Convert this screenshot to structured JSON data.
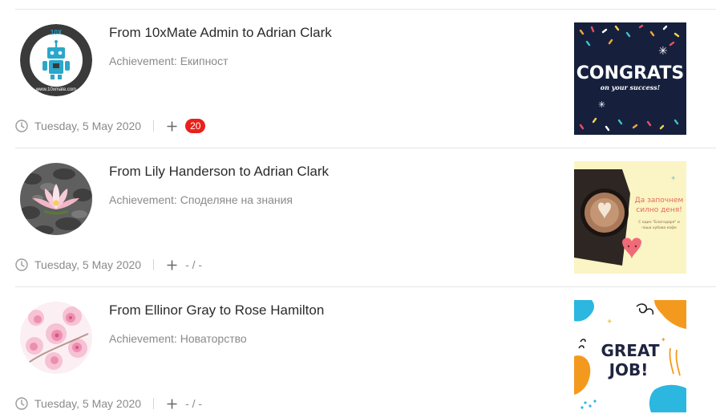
{
  "feed": {
    "items": [
      {
        "title": "From 10xMate Admin to Adrian Clark",
        "achievement": "Achievement: Екипност",
        "date": "Tuesday, 5 May 2020",
        "likes": "20",
        "avatar_icon": "robot-logo-icon",
        "avatar_logo_text": "10X",
        "avatar_url_text": "www.10xmate.com",
        "image_icon": "congrats-card-image",
        "image_text": {
          "main": "CONGRATS",
          "sub": "on your success!"
        }
      },
      {
        "title": "From Lily Handerson to Adrian Clark",
        "achievement": "Achievement: Споделяне на знания",
        "date": "Tuesday, 5 May 2020",
        "likes": "- / -",
        "avatar_icon": "lotus-flower-icon",
        "image_icon": "coffee-card-image",
        "image_text": {
          "main_line1": "Да започнем",
          "main_line2": "силно деня!",
          "sub_line1": "С един \"Благодаря\" и",
          "sub_line2": "чаша хубаво кафе"
        }
      },
      {
        "title": "From Ellinor Gray to Rose Hamilton",
        "achievement": "Achievement: Новаторство",
        "date": "Tuesday, 5 May 2020",
        "likes": "- / -",
        "avatar_icon": "cherry-blossom-icon",
        "image_icon": "great-job-card-image",
        "image_text": {
          "line1": "GREAT",
          "line2": "JOB!"
        }
      }
    ]
  },
  "colors": {
    "badge": "#e8211b",
    "divider": "#e6e6e6",
    "meta_text": "#8a8a8a",
    "title_text": "#2b2b2b"
  }
}
